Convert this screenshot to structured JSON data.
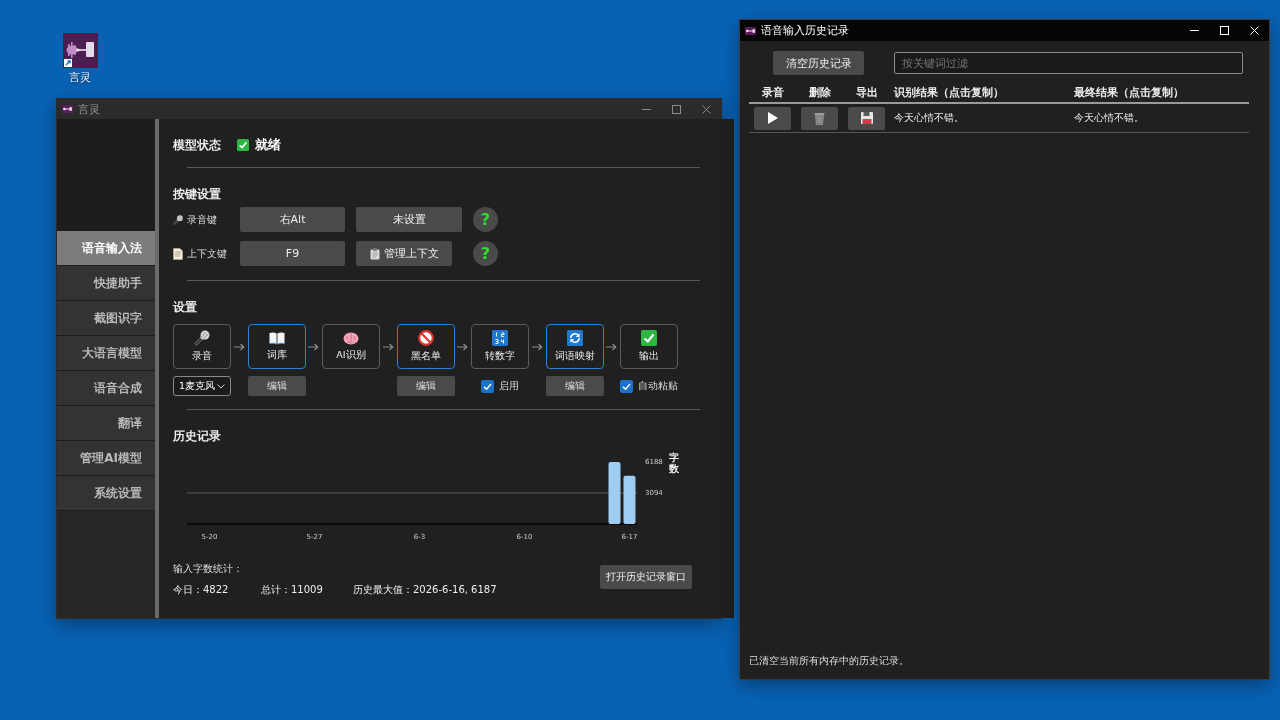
{
  "desktop": {
    "icons": [
      {
        "label": "言灵"
      }
    ]
  },
  "main_window": {
    "title": "言灵",
    "active": false,
    "sidebar": {
      "items": [
        {
          "label": "语音输入法",
          "selected": true
        },
        {
          "label": "快捷助手",
          "selected": false
        },
        {
          "label": "截图识字",
          "selected": false
        },
        {
          "label": "大语言模型",
          "selected": false
        },
        {
          "label": "语音合成",
          "selected": false
        },
        {
          "label": "翻译",
          "selected": false
        },
        {
          "label": "管理AI模型",
          "selected": false
        },
        {
          "label": "系统设置",
          "selected": false
        }
      ]
    },
    "model_status": {
      "label": "模型状态",
      "value": "就绪",
      "ready": true
    },
    "hotkeys": {
      "title": "按键设置",
      "rows": [
        {
          "kind": "record",
          "label": "录音键",
          "buttons": [
            {
              "kind": "key",
              "label": "右Alt"
            },
            {
              "kind": "key",
              "label": "未设置"
            }
          ],
          "help": "?"
        },
        {
          "kind": "context",
          "label": "上下文键",
          "buttons": [
            {
              "kind": "key",
              "label": "F9"
            },
            {
              "kind": "manage",
              "label": "管理上下文"
            }
          ],
          "help": "?"
        }
      ]
    },
    "pipeline": {
      "title": "设置",
      "steps": [
        {
          "kind": "record",
          "label": "录音",
          "highlighted": false,
          "control": {
            "kind": "dropdown",
            "value": "1麦克风"
          }
        },
        {
          "kind": "lexicon",
          "label": "词库",
          "highlighted": true,
          "control": {
            "kind": "button",
            "label": "编辑"
          }
        },
        {
          "kind": "ai",
          "label": "AI识别",
          "highlighted": false
        },
        {
          "kind": "blacklist",
          "label": "黑名单",
          "highlighted": true,
          "control": {
            "kind": "button",
            "label": "编辑"
          }
        },
        {
          "kind": "numbers",
          "label": "转数字",
          "highlighted": false,
          "control": {
            "kind": "checkbox",
            "label": "启用",
            "checked": true
          }
        },
        {
          "kind": "mapping",
          "label": "词语映射",
          "highlighted": true,
          "control": {
            "kind": "button",
            "label": "编辑"
          }
        },
        {
          "kind": "output",
          "label": "输出",
          "highlighted": false,
          "control": {
            "kind": "checkbox",
            "label": "自动粘贴",
            "checked": true
          }
        }
      ]
    },
    "history": {
      "title": "历史记录",
      "chart_data": {
        "type": "bar",
        "ylabel": "字数",
        "categories": [
          "5-20",
          null,
          null,
          null,
          null,
          null,
          null,
          "5-27",
          null,
          null,
          null,
          null,
          null,
          null,
          "6-3",
          null,
          null,
          null,
          null,
          null,
          null,
          "6-10",
          null,
          null,
          null,
          null,
          null,
          null,
          "6-17"
        ],
        "values": [
          null,
          null,
          null,
          null,
          null,
          null,
          null,
          null,
          null,
          null,
          null,
          null,
          null,
          null,
          null,
          null,
          null,
          null,
          null,
          null,
          null,
          null,
          null,
          null,
          null,
          null,
          null,
          6187,
          4822
        ],
        "ylim": [
          0,
          6188
        ],
        "yticks": [
          {
            "value": 3094,
            "label": "3094"
          },
          {
            "value": 6188,
            "label": "6188"
          }
        ]
      },
      "stats_title": "输入字数统计：",
      "stats": [
        "今日：4822",
        "总计：11009",
        "历史最大值：2026-6-16, 6187"
      ],
      "open_button": "打开历史记录窗口"
    }
  },
  "history_window": {
    "title": "语音输入历史记录",
    "active": true,
    "clear_button": "清空历史记录",
    "filter": {
      "placeholder": "按关键词过滤"
    },
    "table": {
      "columns": [
        "录音",
        "删除",
        "导出",
        "识别结果（点击复制）",
        "最终结果（点击复制）"
      ],
      "rows": [
        {
          "recognized": "今天心情不错。",
          "final": "今天心情不错。"
        }
      ]
    },
    "status_bar": "已清空当前所有内存中的历史记录。"
  }
}
